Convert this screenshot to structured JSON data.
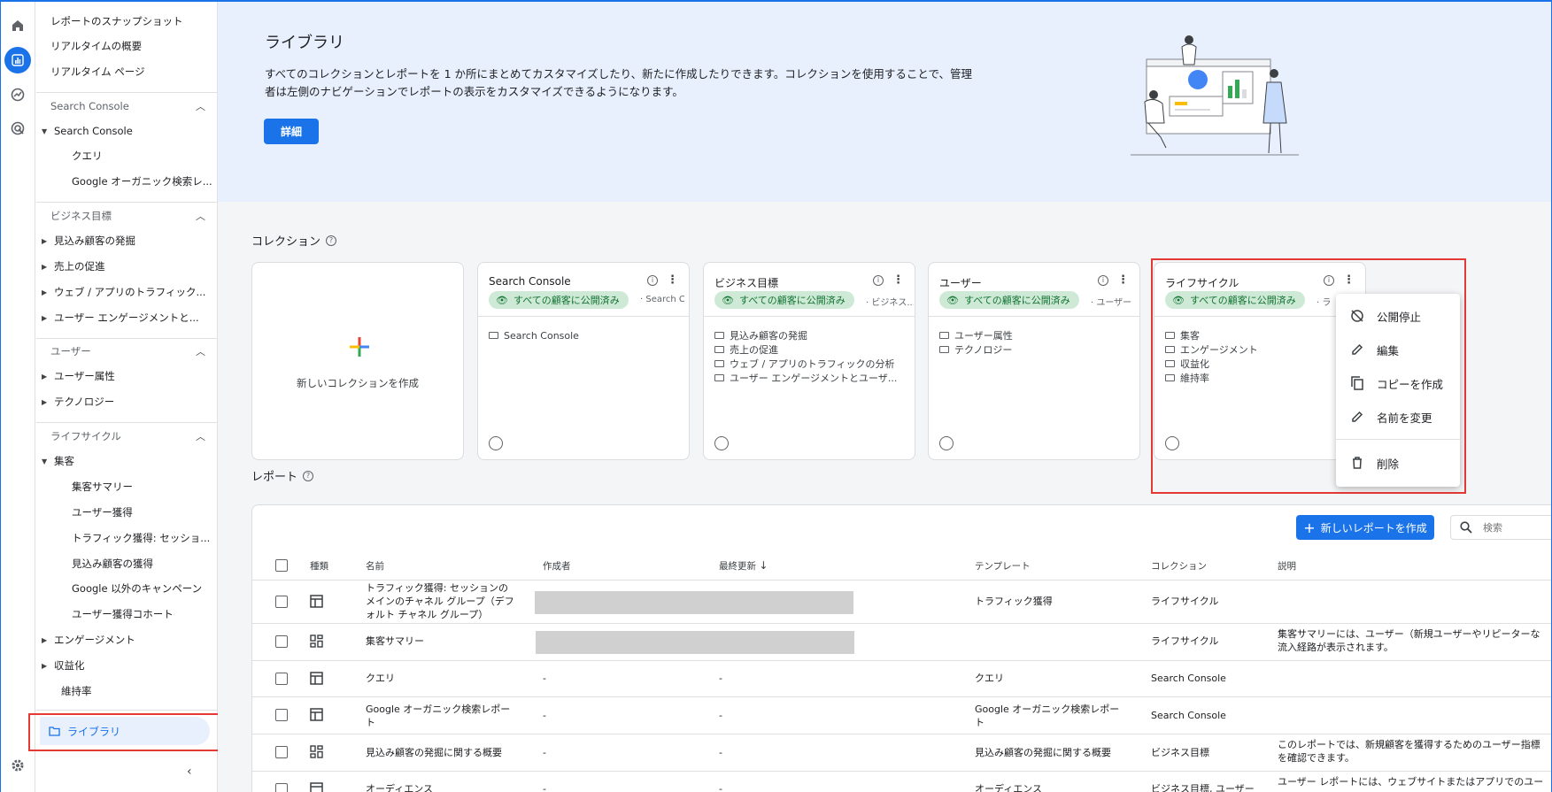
{
  "sidebar": {
    "top_items": [
      "レポートのスナップショット",
      "リアルタイムの概要",
      "リアルタイム ページ"
    ],
    "sections": [
      {
        "header": "Search Console",
        "items": [
          {
            "label": "Search Console",
            "level": 1,
            "caret": "▼"
          },
          {
            "label": "クエリ",
            "level": 2
          },
          {
            "label": "Google オーガニック検索レ...",
            "level": 2
          }
        ]
      },
      {
        "header": "ビジネス目標",
        "items": [
          {
            "label": "見込み顧客の発掘",
            "level": 1,
            "caret": "▶"
          },
          {
            "label": "売上の促進",
            "level": 1,
            "caret": "▶"
          },
          {
            "label": "ウェブ / アプリのトラフィック...",
            "level": 1,
            "caret": "▶"
          },
          {
            "label": "ユーザー エンゲージメントと...",
            "level": 1,
            "caret": "▶"
          }
        ]
      },
      {
        "header": "ユーザー",
        "items": [
          {
            "label": "ユーザー属性",
            "level": 1,
            "caret": "▶"
          },
          {
            "label": "テクノロジー",
            "level": 1,
            "caret": "▶"
          }
        ]
      },
      {
        "header": "ライフサイクル",
        "items": [
          {
            "label": "集客",
            "level": 1,
            "caret": "▼"
          },
          {
            "label": "集客サマリー",
            "level": 2
          },
          {
            "label": "ユーザー獲得",
            "level": 2
          },
          {
            "label": "トラフィック獲得: セッショ...",
            "level": 2
          },
          {
            "label": "見込み顧客の獲得",
            "level": 2
          },
          {
            "label": "Google 以外のキャンペーン",
            "level": 2
          },
          {
            "label": "ユーザー獲得コホート",
            "level": 2
          },
          {
            "label": "エンゲージメント",
            "level": 1,
            "caret": "▶"
          },
          {
            "label": "収益化",
            "level": 1,
            "caret": "▶"
          },
          {
            "label": "維持率",
            "level": 1
          }
        ]
      }
    ],
    "library_label": "ライブラリ"
  },
  "banner": {
    "title": "ライブラリ",
    "description": "すべてのコレクションとレポートを 1 か所にまとめてカスタマイズしたり、新たに作成したりできます。コレクションを使用することで、管理者は左側のナビゲーションでレポートの表示をカスタマイズできるようになります。",
    "details_button": "詳細"
  },
  "collections": {
    "title": "コレクション",
    "new_label": "新しいコレクションを作成",
    "cards": [
      {
        "title": "Search Console",
        "status": "すべての顧客に公開済み",
        "sub": "Search C...",
        "items": [
          "Search Console"
        ]
      },
      {
        "title": "ビジネス目標",
        "status": "すべての顧客に公開済み",
        "sub": "ビジネス...",
        "items": [
          "見込み顧客の発掘",
          "売上の促進",
          "ウェブ / アプリのトラフィックの分析",
          "ユーザー エンゲージメントとユーザ..."
        ]
      },
      {
        "title": "ユーザー",
        "status": "すべての顧客に公開済み",
        "sub": "ユーザー",
        "items": [
          "ユーザー属性",
          "テクノロジー"
        ]
      },
      {
        "title": "ライフサイクル",
        "status": "すべての顧客に公開済み",
        "sub": "ラ",
        "items": [
          "集客",
          "エンゲージメント",
          "収益化",
          "維持率"
        ]
      }
    ]
  },
  "context_menu": {
    "items": [
      "公開停止",
      "編集",
      "コピーを作成",
      "名前を変更",
      "削除"
    ]
  },
  "reports": {
    "title": "レポート",
    "new_button": "新しいレポートを作成",
    "search_placeholder": "検索",
    "headers": {
      "type": "種類",
      "name": "名前",
      "author": "作成者",
      "updated": "最終更新",
      "template": "テンプレート",
      "collection": "コレクション",
      "description": "説明"
    },
    "rows": [
      {
        "icon": "table",
        "name": "トラフィック獲得: セッションのメインのチャネル グループ（デフォルト チャネル グループ）",
        "author": "",
        "updated": "",
        "template": "トラフィック獲得",
        "collection": "ライフサイクル",
        "description": ""
      },
      {
        "icon": "dashboard",
        "name": "集客サマリー",
        "author": "",
        "updated": "",
        "template": "",
        "collection": "ライフサイクル",
        "description": "集客サマリーには、ユーザー（新規ユーザーやリピーターな 流入経路が表示されます。"
      },
      {
        "icon": "table",
        "name": "クエリ",
        "author": "-",
        "updated": "-",
        "template": "クエリ",
        "collection": "Search Console",
        "description": ""
      },
      {
        "icon": "table",
        "name": "Google オーガニック検索レポート",
        "author": "-",
        "updated": "-",
        "template": "Google オーガニック検索レポート",
        "collection": "Search Console",
        "description": ""
      },
      {
        "icon": "dashboard",
        "name": "見込み顧客の発掘に関する概要",
        "author": "-",
        "updated": "-",
        "template": "見込み顧客の発掘に関する概要",
        "collection": "ビジネス目標",
        "description": "このレポートでは、新規顧客を獲得するためのユーザー指標 を確認できます。"
      },
      {
        "icon": "table",
        "name": "オーディエンス",
        "author": "-",
        "updated": "-",
        "template": "オーディエンス",
        "collection": "ビジネス目標, ユーザー",
        "description": "ユーザー レポートには、ウェブサイトまたはアプリでのユー"
      }
    ]
  },
  "colors": {
    "accent": "#1a73e8",
    "highlight_border": "#e53935",
    "pill_bg": "#ceead6",
    "pill_text": "#137333"
  }
}
